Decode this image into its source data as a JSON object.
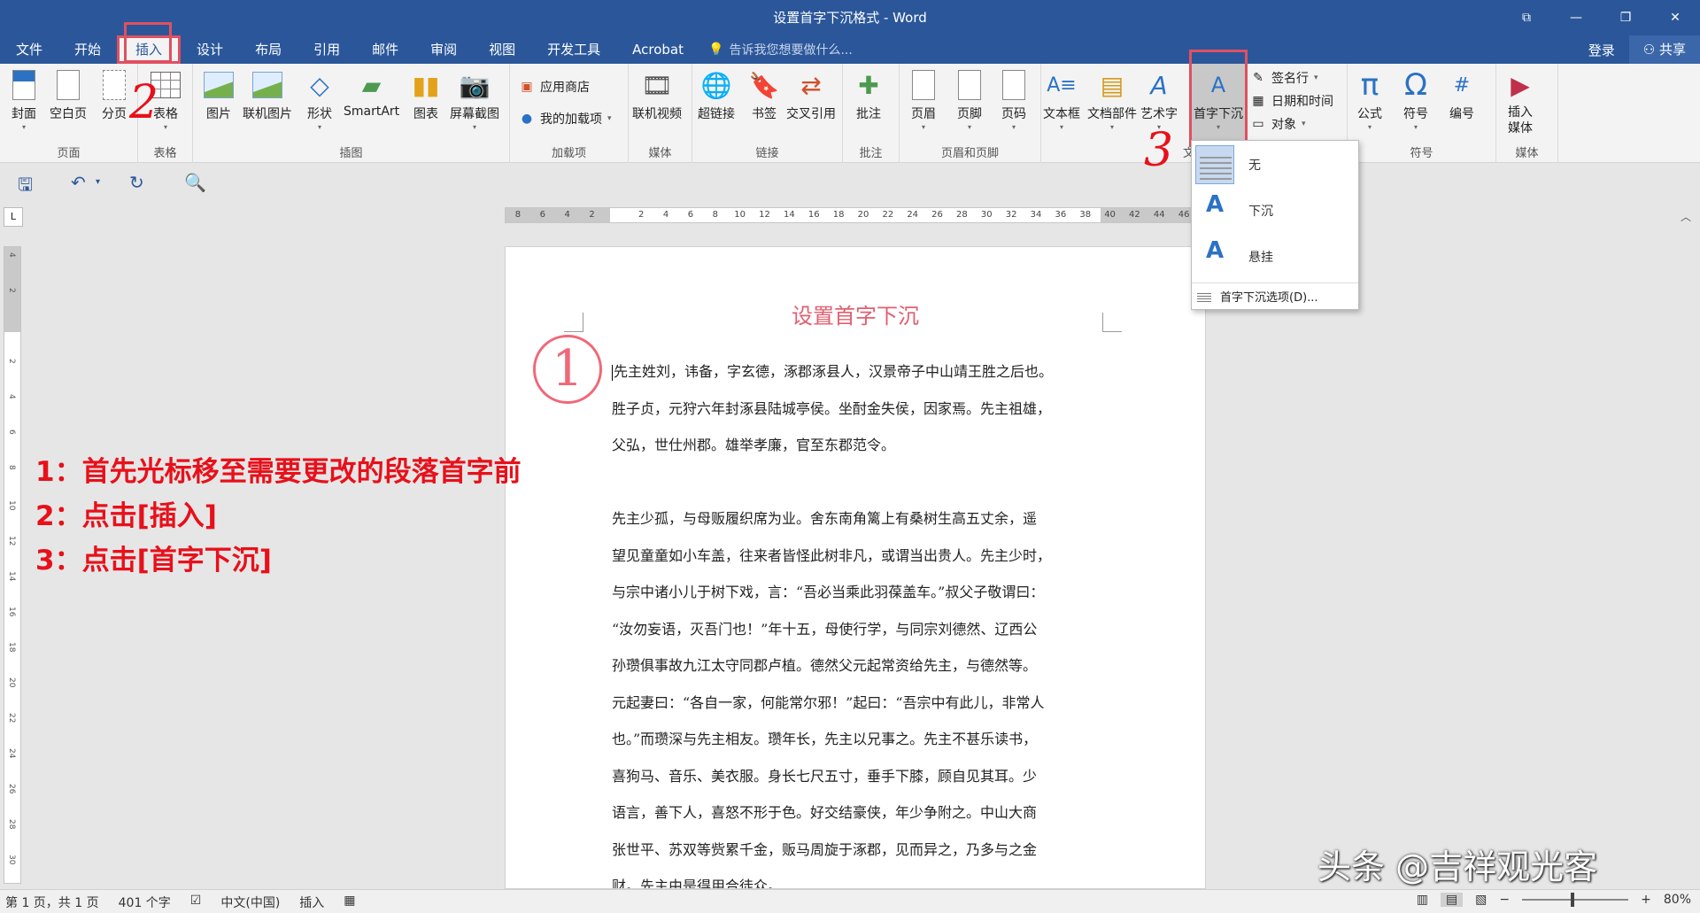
{
  "window": {
    "title": "设置首字下沉格式 - Word"
  },
  "menu": {
    "tabs": [
      "文件",
      "开始",
      "插入",
      "设计",
      "布局",
      "引用",
      "邮件",
      "审阅",
      "视图",
      "开发工具",
      "Acrobat"
    ],
    "active_tab": "插入",
    "tell_me": "告诉我您想要做什么...",
    "login": "登录",
    "share": "共享"
  },
  "ribbon": {
    "pages": {
      "label": "页面",
      "cover": "封面",
      "blank": "空白页",
      "break": "分页"
    },
    "tables": {
      "label": "表格",
      "table": "表格"
    },
    "illustrations": {
      "label": "插图",
      "picture": "图片",
      "online_picture": "联机图片",
      "shapes": "形状",
      "smartart": "SmartArt",
      "chart": "图表",
      "screenshot": "屏幕截图"
    },
    "addins": {
      "label": "加载项",
      "store": "应用商店",
      "my_addins": "我的加载项"
    },
    "media": {
      "label": "媒体",
      "online_video": "联机视频"
    },
    "links": {
      "label": "链接",
      "hyperlink": "超链接",
      "bookmark": "书签",
      "cross_ref": "交叉引用"
    },
    "comments": {
      "label": "批注",
      "comment": "批注"
    },
    "header_footer": {
      "label": "页眉和页脚",
      "header": "页眉",
      "footer": "页脚",
      "page_number": "页码"
    },
    "text": {
      "label": "文",
      "textbox": "文本框",
      "quick_parts": "文档部件",
      "wordart": "艺术字",
      "dropcap": "首字下沉",
      "signature": "签名行",
      "datetime": "日期和时间",
      "object": "对象"
    },
    "symbols": {
      "label": "符号",
      "equation": "公式",
      "symbol": "符号",
      "number": "编号"
    },
    "media2": {
      "label": "媒体",
      "embed": "插入\n媒体"
    }
  },
  "ruler": {
    "numbers": [
      "8",
      "6",
      "4",
      "2",
      "",
      "2",
      "4",
      "6",
      "8",
      "10",
      "12",
      "14",
      "16",
      "18",
      "20",
      "22",
      "24",
      "26",
      "28",
      "30",
      "32",
      "34",
      "36",
      "38",
      "40",
      "42",
      "44",
      "46"
    ]
  },
  "vruler": {
    "numbers": [
      "4",
      "2",
      "",
      "2",
      "4",
      "6",
      "8",
      "10",
      "12",
      "14",
      "16",
      "18",
      "20",
      "22",
      "24",
      "26",
      "28",
      "30"
    ]
  },
  "dropdown": {
    "items": [
      "无",
      "下沉",
      "悬挂"
    ],
    "options": "首字下沉选项(D)..."
  },
  "document": {
    "title": "设置首字下沉",
    "para1": [
      "先主姓刘，讳备，字玄德，涿郡涿县人，汉景帝子中山靖王胜之后也。",
      "胜子贞，元狩六年封涿县陆城亭侯。坐酎金失侯，因家焉。先主祖雄，",
      "父弘，世仕州郡。雄举孝廉，官至东郡范令。"
    ],
    "para2": [
      "先主少孤，与母贩履织席为业。舍东南角篱上有桑树生高五丈余，遥",
      "望见童童如小车盖，往来者皆怪此树非凡，或谓当出贵人。先主少时，",
      "与宗中诸小儿于树下戏，言：“吾必当乘此羽葆盖车。”叔父子敬谓曰：",
      "“汝勿妄语，灭吾门也！”年十五，母使行学，与同宗刘德然、辽西公",
      "孙瓒俱事故九江太守同郡卢植。德然父元起常资给先主，与德然等。",
      "元起妻曰：“各自一家，何能常尔邪！”起曰：“吾宗中有此儿，非常人",
      "也。”而瓒深与先主相友。瓒年长，先主以兄事之。先主不甚乐读书，",
      "喜狗马、音乐、美衣服。身长七尺五寸，垂手下膝，顾自见其耳。少",
      "语言，善下人，喜怒不形于色。好交结豪侠，年少争附之。中山大商",
      "张世平、苏双等赀累千金，贩马周旋于涿郡，见而异之，乃多与之金",
      "财。先主由是得用合徒众。"
    ]
  },
  "annotations": {
    "step1": "1：首先光标移至需要更改的段落首字前",
    "step2": "2：点击[插入]",
    "step3": "3：点击[首字下沉]",
    "circle": "1",
    "num2": "2",
    "num3": "3"
  },
  "status": {
    "page": "第 1 页，共 1 页",
    "words": "401 个字",
    "lang": "中文(中国)",
    "mode": "插入",
    "zoom": "80%"
  },
  "watermark": "头条 @吉祥观光客",
  "colors": {
    "brand": "#2b579a",
    "annotation": "#e8101a",
    "title_pink": "#e06070"
  }
}
